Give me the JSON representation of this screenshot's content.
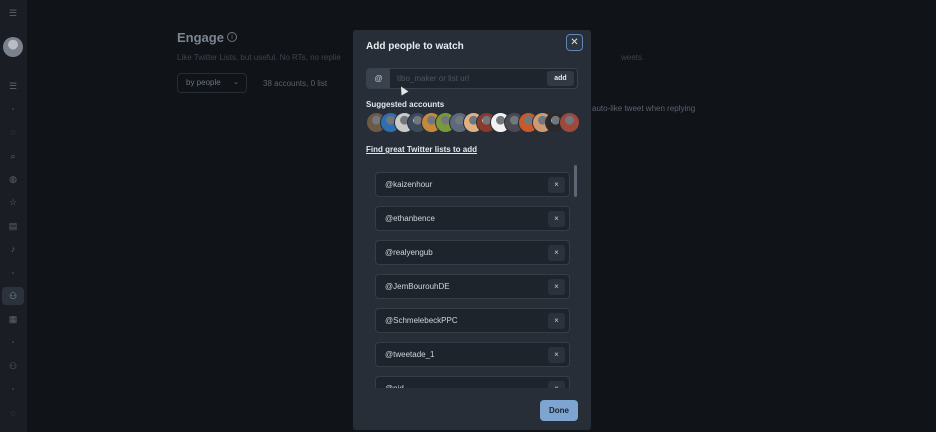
{
  "sidebar": {
    "icons": [
      "menu-icon",
      "list-icon",
      "lightbulb-icon",
      "search-icon",
      "robot-icon",
      "star-icon",
      "database-icon",
      "bell-icon",
      "people-icon",
      "document-icon",
      "group-icon",
      "lightbulb-icon"
    ],
    "active_item": "people-icon"
  },
  "engage": {
    "title": "Engage",
    "subtitle": "Like Twitter Lists, but useful. No RTs, no replie",
    "subtitle_tail": "weets.",
    "filter_label": "by people",
    "count": "38 accounts, 0 list",
    "side_note": "auto-like tweet when replying"
  },
  "modal": {
    "title": "Add people to watch",
    "at_prefix": "@",
    "input_placeholder": "tibo_maker or list url",
    "input_value": "",
    "add_label": "add",
    "suggested_label": "Suggested accounts",
    "suggested_avatar_colors": [
      "#6b5a45",
      "#2f6fb0",
      "#c9c9c9",
      "#3d4a5c",
      "#c48a3a",
      "#7a9a3a",
      "#5a6a7a",
      "#e0b080",
      "#8a3a2a",
      "#f2f2f2",
      "#4a4a52",
      "#c85a2a",
      "#d09a70",
      "#2a2a2a",
      "#a0493a"
    ],
    "find_link": "Find great Twitter lists to add",
    "accounts": [
      "@kaizenhour",
      "@ethanbence",
      "@realyengub",
      "@JemBourouhDE",
      "@SchmelebeckPPC",
      "@tweetade_1",
      "@njd"
    ],
    "remove_label": "×",
    "done_label": "Done",
    "close_label": "✕"
  },
  "colors": {
    "accent": "#7ea5cf",
    "modal_bg": "#272e38",
    "page_bg": "#101317"
  }
}
